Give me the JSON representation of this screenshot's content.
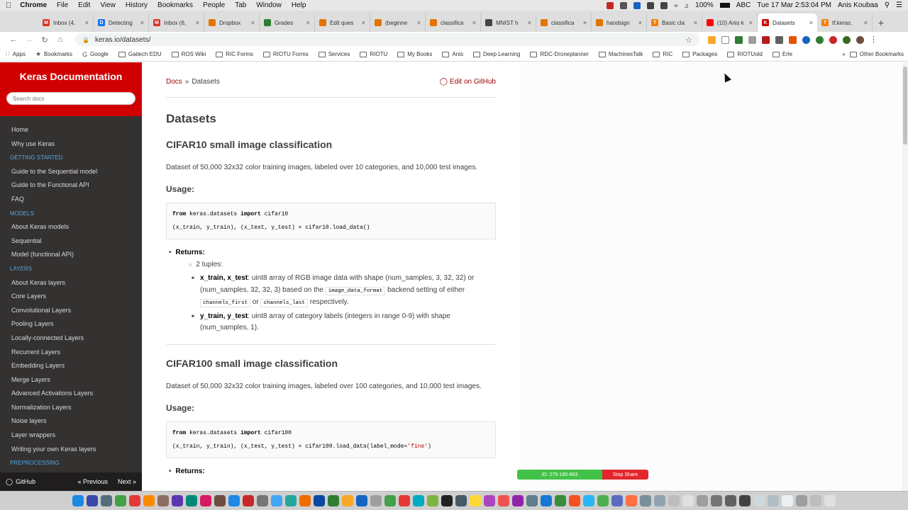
{
  "menubar": {
    "app": "Chrome",
    "items": [
      "File",
      "Edit",
      "View",
      "History",
      "Bookmarks",
      "People",
      "Tab",
      "Window",
      "Help"
    ],
    "battery": "100%",
    "input_source": "ABC",
    "clock": "Tue 17 Mar 2:53:04 PM",
    "user": "Anis Koubaa"
  },
  "tabs": [
    {
      "label": "Inbox (4,",
      "color": "#d93025",
      "glyph": "M"
    },
    {
      "label": "Detecting",
      "color": "#1a73e8",
      "glyph": "D"
    },
    {
      "label": "Inbox (6,",
      "color": "#d93025",
      "glyph": "M"
    },
    {
      "label": "Dropbox",
      "color": "#e37400",
      "glyph": ""
    },
    {
      "label": "Grades",
      "color": "#2e7d32",
      "glyph": ""
    },
    {
      "label": "Edit ques",
      "color": "#e37400",
      "glyph": ""
    },
    {
      "label": "(beginne",
      "color": "#e37400",
      "glyph": ""
    },
    {
      "label": "classifica",
      "color": "#e37400",
      "glyph": ""
    },
    {
      "label": "MNIST h",
      "color": "#444444",
      "glyph": ""
    },
    {
      "label": "classifica",
      "color": "#e37400",
      "glyph": ""
    },
    {
      "label": "handsign",
      "color": "#e37400",
      "glyph": ""
    },
    {
      "label": "Basic cla",
      "color": "#f57c00",
      "glyph": "T"
    },
    {
      "label": "(10) Anis k",
      "color": "#ff0000",
      "glyph": ""
    },
    {
      "label": "Datasets",
      "color": "#d00000",
      "glyph": "K",
      "active": true
    },
    {
      "label": "tf.keras.",
      "color": "#f57c00",
      "glyph": "T"
    }
  ],
  "address": {
    "url": "keras.io/datasets/"
  },
  "bookmarks": {
    "items": [
      "Apps",
      "Bookmarks",
      "Google",
      "Gaitech EDU",
      "ROS Wiki",
      "RIC Forms",
      "RIOTU Forms",
      "Services",
      "RIOTU",
      "My Books",
      "Anis",
      "Deep Learning",
      "RDC-Droneplanner",
      "MachinesTalk",
      "RIC",
      "Packages",
      "RIOTUold",
      "Erle"
    ],
    "overflow": "»",
    "other": "Other Bookmarks"
  },
  "sidebar": {
    "title": "Keras Documentation",
    "search_placeholder": "Search docs",
    "nav": [
      {
        "type": "item",
        "label": "Home"
      },
      {
        "type": "item",
        "label": "Why use Keras"
      },
      {
        "type": "sect",
        "label": "Getting started"
      },
      {
        "type": "item",
        "label": "Guide to the Sequential model"
      },
      {
        "type": "item",
        "label": "Guide to the Functional API"
      },
      {
        "type": "item",
        "label": "FAQ"
      },
      {
        "type": "sect",
        "label": "Models"
      },
      {
        "type": "item",
        "label": "About Keras models"
      },
      {
        "type": "item",
        "label": "Sequential"
      },
      {
        "type": "item",
        "label": "Model (functional API)"
      },
      {
        "type": "sect",
        "label": "Layers"
      },
      {
        "type": "item",
        "label": "About Keras layers"
      },
      {
        "type": "item",
        "label": "Core Layers"
      },
      {
        "type": "item",
        "label": "Convolutional Layers"
      },
      {
        "type": "item",
        "label": "Pooling Layers"
      },
      {
        "type": "item",
        "label": "Locally-connected Layers"
      },
      {
        "type": "item",
        "label": "Recurrent Layers"
      },
      {
        "type": "item",
        "label": "Embedding Layers"
      },
      {
        "type": "item",
        "label": "Merge Layers"
      },
      {
        "type": "item",
        "label": "Advanced Activations Layers"
      },
      {
        "type": "item",
        "label": "Normalization Layers"
      },
      {
        "type": "item",
        "label": "Noise layers"
      },
      {
        "type": "item",
        "label": "Layer wrappers"
      },
      {
        "type": "item",
        "label": "Writing your own Keras layers"
      },
      {
        "type": "sect",
        "label": "Preprocessing"
      }
    ],
    "footer": {
      "github": "GitHub",
      "prev": "« Previous",
      "next": "Next »"
    }
  },
  "content": {
    "breadcrumb": {
      "docs": "Docs",
      "sep": "»",
      "current": "Datasets",
      "edit": "Edit on GitHub"
    },
    "title": "Datasets",
    "cifar10": {
      "heading": "CIFAR10 small image classification",
      "desc": "Dataset of 50,000 32x32 color training images, labeled over 10 categories, and 10,000 test images.",
      "usage": "Usage:",
      "code_kw_from": "from",
      "code_mod": " keras.datasets ",
      "code_kw_import": "import",
      "code_name": " cifar10",
      "code_line2": "(x_train, y_train), (x_test, y_test) = cifar10.load_data()",
      "returns": "Returns:",
      "tuples": "2 tuples:",
      "xname": "x_train, x_test",
      "xdesc1": ": uint8 array of RGB image data with shape (num_samples, 3, 32, 32) or (num_samples, 32, 32, 3) based on the ",
      "xcode1": "image_data_format",
      "xdesc2": " backend setting of either ",
      "xcode2": "channels_first",
      "xdesc3": " or ",
      "xcode3": "channels_last",
      "xdesc4": " respectively.",
      "yname": "y_train, y_test",
      "ydesc": ": uint8 array of category labels (integers in range 0-9) with shape (num_samples, 1)."
    },
    "cifar100": {
      "heading": "CIFAR100 small image classification",
      "desc": "Dataset of 50,000 32x32 color training images, labeled over 100 categories, and 10,000 test images.",
      "usage": "Usage:",
      "code_kw_from": "from",
      "code_mod": " keras.datasets ",
      "code_kw_import": "import",
      "code_name": " cifar100",
      "code_line2a": "(x_train, y_train), (x_test, y_test) = cifar100.load_data(label_mode=",
      "code_line2str": "'fine'",
      "code_line2b": ")",
      "returns": "Returns:"
    }
  },
  "share_bar": {
    "id": "ID: 275-180-893",
    "stop": "Stop Share"
  },
  "colors": {
    "keras_red": "#d00000",
    "sidebar_bg": "#343131",
    "link": "#980000",
    "section": "#55a5d9"
  }
}
